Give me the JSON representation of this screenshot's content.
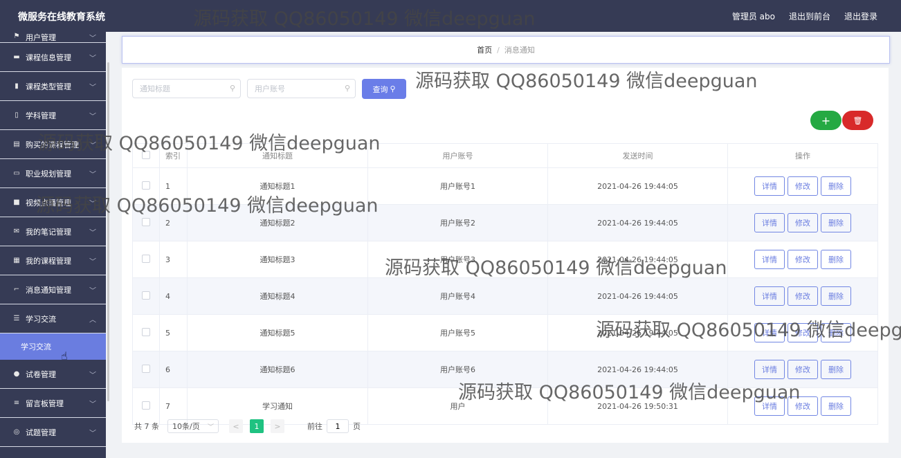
{
  "header": {
    "app_title": "微服务在线教育系统",
    "links": [
      "管理员 abo",
      "退出到前台",
      "退出登录"
    ]
  },
  "sidebar": {
    "items": [
      {
        "label": "用户管理",
        "icon": "flag-icon"
      },
      {
        "label": "课程信息管理",
        "icon": "briefcase-icon"
      },
      {
        "label": "课程类型管理",
        "icon": "bar-chart-icon"
      },
      {
        "label": "学科管理",
        "icon": "phone-icon"
      },
      {
        "label": "购买的课程管理",
        "icon": "clipboard-icon"
      },
      {
        "label": "职业规划管理",
        "icon": "monitor-icon"
      },
      {
        "label": "视频点播管理",
        "icon": "video-icon"
      },
      {
        "label": "我的笔记管理",
        "icon": "mail-icon"
      },
      {
        "label": "我的课程管理",
        "icon": "grid-icon"
      },
      {
        "label": "消息通知管理",
        "icon": "crop-icon"
      },
      {
        "label": "学习交流",
        "icon": "sliders-icon",
        "expanded": true
      },
      {
        "label": "试卷管理",
        "icon": "user-icon"
      },
      {
        "label": "留言板管理",
        "icon": "list-icon"
      },
      {
        "label": "试题管理",
        "icon": "compass-icon"
      }
    ],
    "sub_item": "学习交流"
  },
  "breadcrumb": {
    "home": "首页",
    "sep": "/",
    "current": "消息通知"
  },
  "search": {
    "title_placeholder": "通知标题",
    "account_placeholder": "用户账号",
    "query_label": "查询"
  },
  "actions": {
    "add_symbol": "+",
    "delete_symbol": "🗑"
  },
  "table": {
    "headers": [
      "索引",
      "通知标题",
      "用户账号",
      "发送时间",
      "操作"
    ],
    "rows": [
      {
        "idx": "1",
        "title": "通知标题1",
        "account": "用户账号1",
        "time": "2021-04-26 19:44:05"
      },
      {
        "idx": "2",
        "title": "通知标题2",
        "account": "用户账号2",
        "time": "2021-04-26 19:44:05"
      },
      {
        "idx": "3",
        "title": "通知标题3",
        "account": "用户账号3",
        "time": "2021-04-26 19:44:05"
      },
      {
        "idx": "4",
        "title": "通知标题4",
        "account": "用户账号4",
        "time": "2021-04-26 19:44:05"
      },
      {
        "idx": "5",
        "title": "通知标题5",
        "account": "用户账号5",
        "time": "2021-04-26 19:44:05"
      },
      {
        "idx": "6",
        "title": "通知标题6",
        "account": "用户账号6",
        "time": "2021-04-26 19:44:05"
      },
      {
        "idx": "7",
        "title": "学习通知",
        "account": "用户",
        "time": "2021-04-26 19:50:31"
      }
    ],
    "op_buttons": [
      "详情",
      "修改",
      "删除"
    ]
  },
  "pagination": {
    "total": "共 7 条",
    "page_size": "10条/页",
    "prev": "<",
    "current_page": "1",
    "next": ">",
    "goto_label": "前往",
    "goto_value": "1",
    "page_suffix": "页"
  },
  "watermark": "源码获取 QQ86050149 微信deepguan",
  "colors": {
    "sidebar_bg": "#363b55",
    "accent": "#6a7de8",
    "add_green": "#25a943",
    "delete_red": "#d82a2a",
    "pager_green": "#1fc281"
  }
}
